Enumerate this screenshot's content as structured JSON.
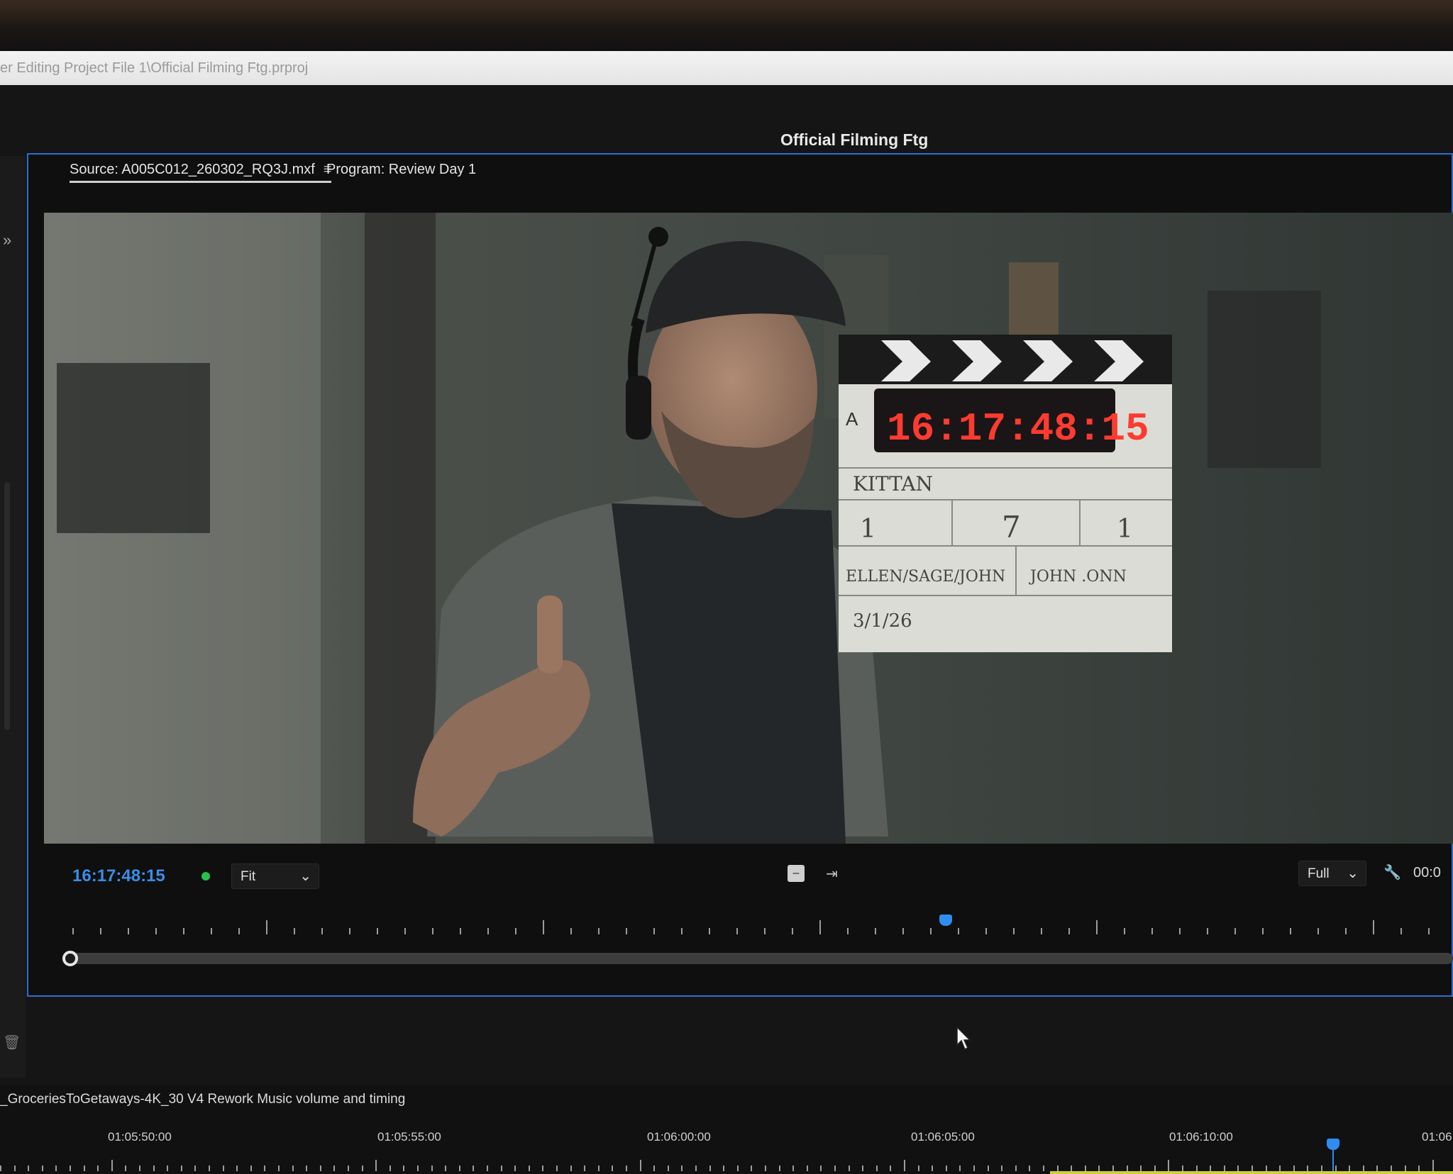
{
  "window": {
    "path": "er Editing Project File 1\\Official Filming Ftg.prproj"
  },
  "workspace": {
    "title": "Official Filming Ftg"
  },
  "monitor": {
    "tabs": [
      {
        "label": "Source: A005C012_260302_RQ3J.mxf",
        "active": true
      },
      {
        "label": "Program: Review Day 1",
        "active": false
      }
    ],
    "timecode": "16:17:48:15",
    "fit_label": "Fit",
    "resolution_label": "Full",
    "duration_partial": "00:0",
    "playhead_position": 0.63,
    "icons": [
      "panel-menu-icon",
      "insert-icon",
      "overwrite-icon",
      "wrench-icon",
      "expand-panels-icon",
      "trash-icon"
    ]
  },
  "slate": {
    "timecode": "16:17:48:15",
    "roll": "A",
    "production": "KITTAN",
    "scene": "1",
    "take_a": "7",
    "take_b": "1",
    "director": "ELLEN/SAGE/JOHN",
    "camera": "JOHN .ONN",
    "date": "3/1/26"
  },
  "timeline": {
    "sequence_name": "_GroceriesToGetaways-4K_30 V4 Rework Music volume and timing",
    "ruler_labels": [
      "01:05:50:00",
      "01:05:55:00",
      "01:06:00:00",
      "01:06:05:00",
      "01:06:10:00",
      "01:06:"
    ]
  },
  "colors": {
    "accent_blue": "#2b6ed1",
    "timecode_blue": "#3a8ee6",
    "status_green": "#27c24a",
    "slate_red": "#ff3b30"
  }
}
